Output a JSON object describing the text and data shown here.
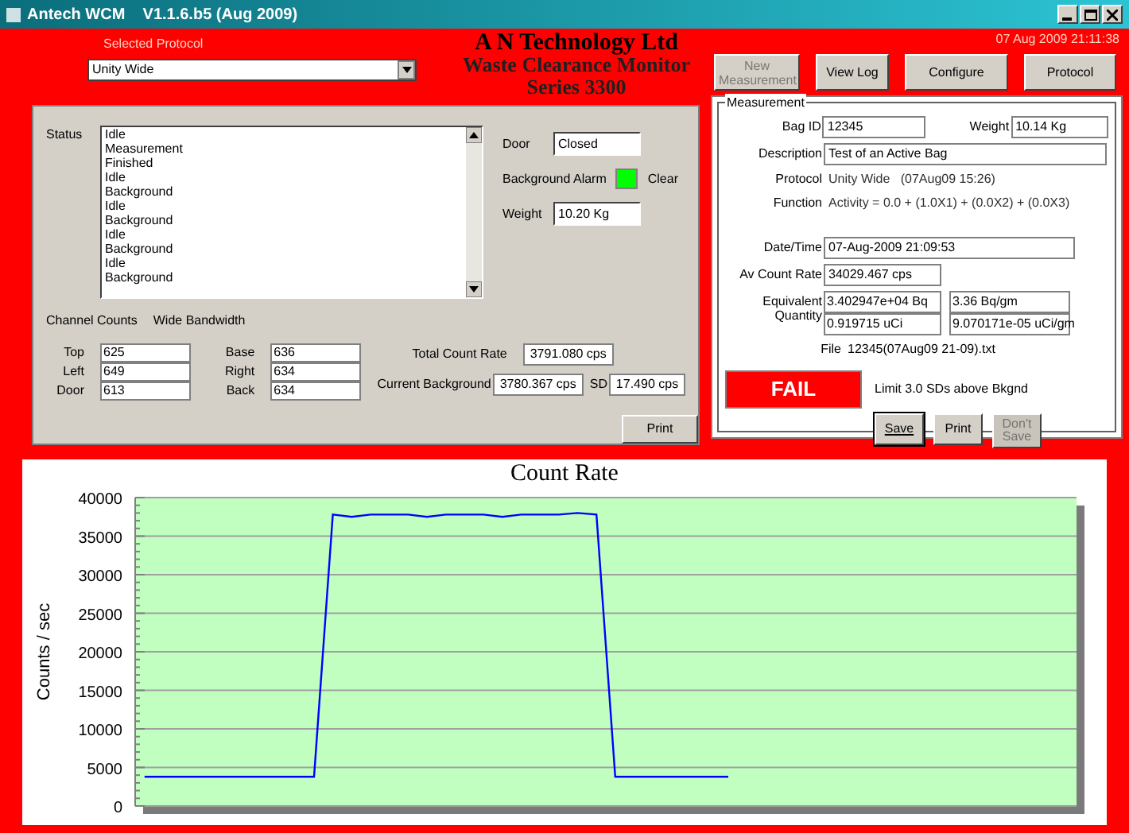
{
  "window": {
    "title": "Antech WCM    V1.1.6.b5 (Aug 2009)"
  },
  "header": {
    "protocol_label": "Selected Protocol",
    "protocol_value": "Unity Wide",
    "company": [
      "A N Technology Ltd",
      "Waste Clearance Monitor",
      "Series 3300"
    ],
    "datetime": "07 Aug 2009  21:11:38",
    "buttons": [
      {
        "label": "New Measurement",
        "disabled": true
      },
      {
        "label": "View Log",
        "disabled": false
      },
      {
        "label": "Configure",
        "disabled": false
      },
      {
        "label": "Protocol",
        "disabled": false
      }
    ]
  },
  "status": {
    "label": "Status",
    "items": [
      "Idle",
      "Measurement",
      "Finished",
      "Idle",
      "Background",
      "Idle",
      "Background",
      "Idle",
      "Background",
      "Idle",
      "Background"
    ],
    "door_label": "Door",
    "door_value": "Closed",
    "alarm_label": "Background Alarm",
    "alarm_active": false,
    "alarm_value": "Clear",
    "weight_label": "Weight",
    "weight_value": "10.20 Kg"
  },
  "channel_counts": {
    "label": "Channel Counts",
    "bandwidth": "Wide Bandwidth",
    "channels": [
      {
        "name": "Top",
        "value": "625"
      },
      {
        "name": "Left",
        "value": "649"
      },
      {
        "name": "Door",
        "value": "613"
      },
      {
        "name": "Base",
        "value": "636"
      },
      {
        "name": "Right",
        "value": "634"
      },
      {
        "name": "Back",
        "value": "634"
      }
    ],
    "total_label": "Total Count Rate",
    "total_value": "3791.080 cps",
    "background_label": "Current Background",
    "background_value": "3780.367 cps",
    "sd_label": "SD",
    "sd_value": "17.490 cps",
    "print": "Print"
  },
  "measurement": {
    "legend": "Measurement",
    "bag_id_label": "Bag ID",
    "bag_id": "12345",
    "weight_label": "Weight",
    "weight": "10.14 Kg",
    "description_label": "Description",
    "description": "Test of an Active Bag",
    "protocol_label": "Protocol",
    "protocol": "Unity Wide   (07Aug09 15:26)",
    "function_label": "Function",
    "function": "Activity = 0.0 + (1.0X1) + (0.0X2) + (0.0X3)",
    "datetime_label": "Date/Time",
    "datetime": "07-Aug-2009  21:09:53",
    "av_label": "Av Count Rate",
    "av_value": "34029.467 cps",
    "quantity_label": "Equivalent Quantity",
    "quantities": [
      "3.402947e+04 Bq",
      "3.36 Bq/gm",
      "0.919715 uCi",
      "9.070171e-05 uCi/gm"
    ],
    "file_label": "File",
    "file": "12345(07Aug09 21-09).txt",
    "result": {
      "text": "FAIL",
      "passed": false
    },
    "limit": "Limit  3.0 SDs above Bkgnd",
    "buttons": [
      {
        "label": "Save",
        "disabled": false
      },
      {
        "label": "Print",
        "disabled": false
      },
      {
        "label": "Don't Save",
        "disabled": true
      }
    ]
  },
  "chart": {
    "chart_data": {
      "type": "line",
      "title": "Count Rate",
      "ylabel": "Counts / sec",
      "grid": true,
      "ylim": [
        0,
        40000
      ],
      "yticks": [
        0,
        5000,
        10000,
        15000,
        20000,
        25000,
        30000,
        35000,
        40000
      ],
      "categories": [
        null,
        null,
        null,
        null,
        null,
        null,
        null,
        null,
        null,
        null,
        null,
        null,
        null,
        null,
        null,
        null,
        null,
        null,
        null,
        null,
        null,
        null,
        null,
        null,
        null,
        null,
        null,
        null,
        null,
        null,
        null,
        null,
        null,
        null,
        null,
        null,
        null,
        null,
        null,
        null,
        null,
        null,
        null,
        null,
        null,
        null,
        null,
        null,
        null,
        null
      ],
      "series": [
        {
          "color": "#0000ff",
          "values": [
            3800,
            3800,
            3800,
            3800,
            3800,
            3800,
            3800,
            3800,
            3800,
            3800,
            37800,
            37500,
            37800,
            37800,
            37800,
            37500,
            37800,
            37800,
            37800,
            37500,
            37800,
            37800,
            37800,
            38000,
            37800,
            3800,
            3800,
            3800,
            3800,
            3800,
            3800,
            3800,
            null,
            null,
            null,
            null,
            null,
            null,
            null,
            null,
            null,
            null,
            null,
            null,
            null,
            null,
            null,
            null,
            null,
            null
          ]
        }
      ]
    }
  }
}
